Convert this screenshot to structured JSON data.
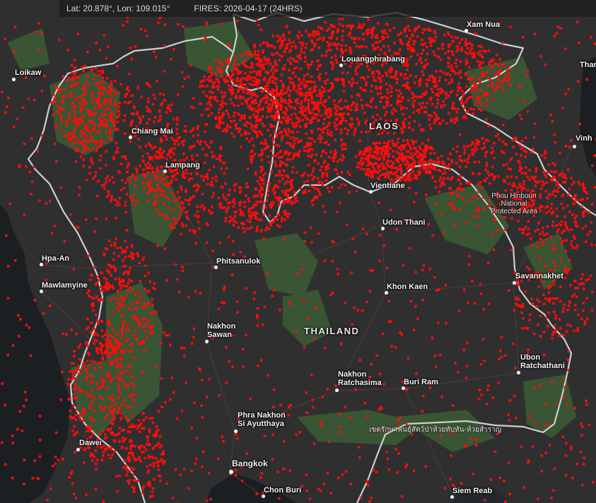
{
  "status": {
    "coordinates": "Lat: 20.878°, Lon: 109.015°",
    "fires_label": "FIRES: 2026-04-17 (24HRS)"
  },
  "countries": {
    "laos": "LAOS",
    "thailand": "THAILAND"
  },
  "cities": {
    "xam_nua": "Xam Nua",
    "louangphrabang": "Louangphrabang",
    "loikaw": "Loikaw",
    "chiang_mai": "Chiang Mai",
    "lampang": "Lampang",
    "vientiane": "Vientiane",
    "udon_thani": "Udon Thani",
    "hpa_an": "Hpa-An",
    "mawlamyine": "Mawlamyine",
    "phitsanulok": "Phitsanulok",
    "khon_kaen": "Khon Kaen",
    "savannakhet": "Savannakhet",
    "nakhon_sawan_1": "Nakhon",
    "nakhon_sawan_2": "Sawan",
    "nakhon_ratchasima_1": "Nakhon",
    "nakhon_ratchasima_2": "Ratchasima",
    "buri_ram": "Buri Ram",
    "ubon_1": "Ubon",
    "ubon_2": "Ratchathani",
    "ayutthaya_1": "Phra Nakhon",
    "ayutthaya_2": "Si Ayutthaya",
    "dawei": "Dawei",
    "bangkok": "Bangkok",
    "chon_buri": "Chon Buri",
    "siem_reab": "Siem Reab",
    "vinh": "Vinh",
    "thanh_partial": "Thar"
  },
  "parks": {
    "phou_hinboun_1": "Phou Hinboun",
    "phou_hinboun_2": "National",
    "phou_hinboun_3": "Protected Area",
    "thai_sanctuary": "เขตรักษาพันธุ์สัตว์ป่าห้วยทับทัน-ห้วยสำราญ"
  },
  "colors": {
    "land": "#2f2f30",
    "water": "#1c1f22",
    "forest": "#3b5a34",
    "border": "#cfcfcf",
    "fire": "#ff0d0d",
    "road": "#5a3f3a"
  }
}
